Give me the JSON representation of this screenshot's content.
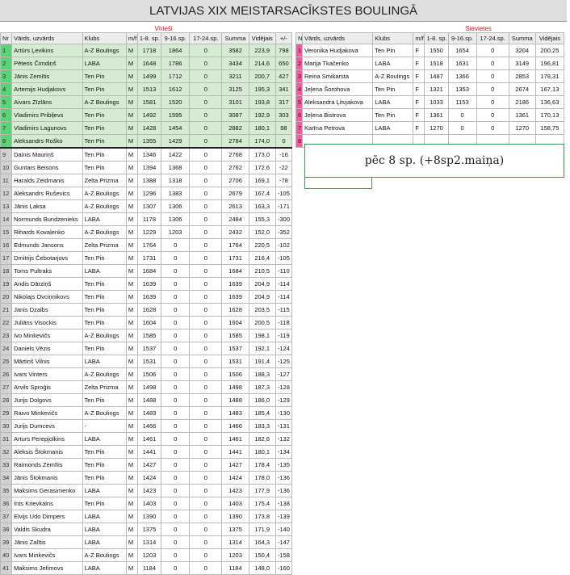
{
  "title": "LATVIJAS XIX MEISTARSACĪKSTES BOULINGĀ",
  "men": {
    "section_label": "Vīrieši",
    "headers": [
      "Nr",
      "Vārds, uzvārds",
      "Klubs",
      "m/f",
      "1-8. sp.",
      "9-16.sp.",
      "17-24.sp.",
      "Summa",
      "Vidējais",
      "+/-"
    ],
    "rows": [
      [
        "1",
        "Artūrs Ļevikins",
        "A-Z Boulings",
        "M",
        "1718",
        "1864",
        "0",
        "3582",
        "223,9",
        "798"
      ],
      [
        "2",
        "Pēteris Čimdiņš",
        "LABA",
        "M",
        "1648",
        "1786",
        "0",
        "3434",
        "214,6",
        "650"
      ],
      [
        "3",
        "Jānis Zemītis",
        "Ten Pin",
        "M",
        "1499",
        "1712",
        "0",
        "3211",
        "200,7",
        "427"
      ],
      [
        "4",
        "Artemijs Hudjakovs",
        "Ten Pin",
        "M",
        "1513",
        "1612",
        "0",
        "3125",
        "195,3",
        "341"
      ],
      [
        "5",
        "Aivars Zīzlāns",
        "A-Z Boulings",
        "M",
        "1581",
        "1520",
        "0",
        "3101",
        "193,8",
        "317"
      ],
      [
        "6",
        "Vladimirs Pribiļevs",
        "Ten Pin",
        "M",
        "1492",
        "1595",
        "0",
        "3087",
        "192,9",
        "303"
      ],
      [
        "7",
        "Vladimirs Lagunovs",
        "Ten Pin",
        "M",
        "1428",
        "1454",
        "0",
        "2882",
        "180,1",
        "98"
      ],
      [
        "8",
        "Aleksandrs Roško",
        "Ten Pin",
        "M",
        "1355",
        "1429",
        "0",
        "2784",
        "174,0",
        "0"
      ],
      [
        "9",
        "Dainis Mauriņš",
        "Ten Pin",
        "M",
        "1346",
        "1422",
        "0",
        "2768",
        "173,0",
        "-16"
      ],
      [
        "10",
        "Guntars Beisons",
        "Ten Pin",
        "M",
        "1394",
        "1368",
        "0",
        "2762",
        "172,6",
        "-22"
      ],
      [
        "11",
        "Haralds Zeidmanis",
        "Zelta Prizma",
        "M",
        "1388",
        "1318",
        "0",
        "2706",
        "169,1",
        "-78"
      ],
      [
        "12",
        "Aleksandrs Ruševics",
        "A-Z Boulings",
        "M",
        "1296",
        "1383",
        "0",
        "2679",
        "167,4",
        "-105"
      ],
      [
        "13",
        "Jānis Ļaksa",
        "A-Z Boulings",
        "M",
        "1307",
        "1306",
        "0",
        "2613",
        "163,3",
        "-171"
      ],
      [
        "14",
        "Normunds Bundzenieks",
        "LABA",
        "M",
        "1178",
        "1306",
        "0",
        "2484",
        "155,3",
        "-300"
      ],
      [
        "15",
        "Rihards Kovaļenko",
        "A-Z Boulings",
        "M",
        "1229",
        "1203",
        "0",
        "2432",
        "152,0",
        "-352"
      ],
      [
        "16",
        "Edmunds Jansons",
        "Zelta Prizma",
        "M",
        "1764",
        "0",
        "0",
        "1764",
        "220,5",
        "-102"
      ],
      [
        "17",
        "Dmitrijs Čebotarjovs",
        "Ten Pin",
        "M",
        "1731",
        "0",
        "0",
        "1731",
        "216,4",
        "-105"
      ],
      [
        "18",
        "Toms Pultraks",
        "LABA",
        "M",
        "1684",
        "0",
        "0",
        "1684",
        "210,5",
        "-110"
      ],
      [
        "19",
        "Andis Dārziņš",
        "Ten Pin",
        "M",
        "1639",
        "0",
        "0",
        "1639",
        "204,9",
        "-114"
      ],
      [
        "20",
        "Nikolajs Ovciņņikovs",
        "Ten Pin",
        "M",
        "1639",
        "0",
        "0",
        "1639",
        "204,9",
        "-114"
      ],
      [
        "21",
        "Janis Dzalbs",
        "Ten Pin",
        "M",
        "1628",
        "0",
        "0",
        "1628",
        "203,5",
        "-115"
      ],
      [
        "22",
        "Juliāns Visockis",
        "Ten Pin",
        "M",
        "1604",
        "0",
        "0",
        "1604",
        "200,5",
        "-118"
      ],
      [
        "23",
        "Ivo Minkevičs",
        "A-Z Boulings",
        "M",
        "1585",
        "0",
        "0",
        "1585",
        "198,1",
        "-119"
      ],
      [
        "24",
        "Daniels Vēzis",
        "Ten Pin",
        "M",
        "1537",
        "0",
        "0",
        "1537",
        "192,1",
        "-124"
      ],
      [
        "25",
        "Mārtiņš Vilnis",
        "LABA",
        "M",
        "1531",
        "0",
        "0",
        "1531",
        "191,4",
        "-125"
      ],
      [
        "26",
        "Ivars Vinters",
        "A-Z Boulings",
        "M",
        "1506",
        "0",
        "0",
        "1506",
        "188,3",
        "-127"
      ],
      [
        "27",
        "Arvils Sproģis",
        "Zelta Prizma",
        "M",
        "1498",
        "0",
        "0",
        "1498",
        "187,3",
        "-128"
      ],
      [
        "28",
        "Jurijs Dolgovs",
        "Ten Pin",
        "M",
        "1488",
        "0",
        "0",
        "1488",
        "186,0",
        "-129"
      ],
      [
        "29",
        "Raivo Minkevičs",
        "A-Z Boulings",
        "M",
        "1483",
        "0",
        "0",
        "1483",
        "185,4",
        "-130"
      ],
      [
        "30",
        "Jurijs Dumcevs",
        "-",
        "M",
        "1466",
        "0",
        "0",
        "1466",
        "183,3",
        "-131"
      ],
      [
        "31",
        "Arturs Perepjolkins",
        "LABA",
        "M",
        "1461",
        "0",
        "0",
        "1461",
        "182,6",
        "-132"
      ],
      [
        "32",
        "Aleksis Štokmanis",
        "Ten Pin",
        "M",
        "1441",
        "0",
        "0",
        "1441",
        "180,1",
        "-134"
      ],
      [
        "33",
        "Raimonds Zemītis",
        "Ten Pin",
        "M",
        "1427",
        "0",
        "0",
        "1427",
        "178,4",
        "-135"
      ],
      [
        "34",
        "Jānis Štokmanis",
        "Ten Pin",
        "M",
        "1424",
        "0",
        "0",
        "1424",
        "178,0",
        "-136"
      ],
      [
        "35",
        "Maksims Gerasimenko",
        "LABA",
        "M",
        "1423",
        "0",
        "0",
        "1423",
        "177,9",
        "-136"
      ],
      [
        "36",
        "Ints Krievkalns",
        "Ten Pin",
        "M",
        "1403",
        "0",
        "0",
        "1403",
        "175,4",
        "-138"
      ],
      [
        "37",
        "Elvijs Udo Dimpers",
        "LABA",
        "M",
        "1390",
        "0",
        "0",
        "1390",
        "173,8",
        "-139"
      ],
      [
        "38",
        "Valdis Skudra",
        "LABA",
        "M",
        "1375",
        "0",
        "0",
        "1375",
        "171,9",
        "-140"
      ],
      [
        "39",
        "Jānis Zalītis",
        "LABA",
        "M",
        "1314",
        "0",
        "0",
        "1314",
        "164,3",
        "-147"
      ],
      [
        "40",
        "Ivars Minkevičs",
        "A-Z Boulings",
        "M",
        "1203",
        "0",
        "0",
        "1203",
        "150,4",
        "-158"
      ],
      [
        "41",
        "Maksims Jefimovs",
        "LABA",
        "M",
        "1184",
        "0",
        "0",
        "1184",
        "148,0",
        "-160"
      ]
    ]
  },
  "women": {
    "section_label": "Sievietes",
    "headers": [
      "Nr",
      "Vārds, uzvārds",
      "Klubs",
      "m/f",
      "1-8. sp.",
      "9-16.sp.",
      "17-24.sp.",
      "Summa",
      "Vidējais"
    ],
    "rows": [
      [
        "1",
        "Veronika Hudjakova",
        "Ten Pin",
        "F",
        "1550",
        "1654",
        "0",
        "3204",
        "200,25"
      ],
      [
        "2",
        "Marija Tkačenko",
        "LABA",
        "F",
        "1518",
        "1631",
        "0",
        "3149",
        "196,81"
      ],
      [
        "3",
        "Reina Smikarsta",
        "A-Z Boulings",
        "F",
        "1487",
        "1366",
        "0",
        "2853",
        "178,31"
      ],
      [
        "4",
        "Jeļena Šorohova",
        "Ten Pin",
        "F",
        "1321",
        "1353",
        "0",
        "2674",
        "167,13"
      ],
      [
        "5",
        "Aleksandra Ļitvjakova",
        "LABA",
        "F",
        "1033",
        "1153",
        "0",
        "2186",
        "136,63"
      ],
      [
        "6",
        "Jeļena Bistrova",
        "Ten Pin",
        "F",
        "1361",
        "0",
        "0",
        "1361",
        "170,13"
      ],
      [
        "7",
        "Karīna Petrova",
        "LABA",
        "F",
        "1270",
        "0",
        "0",
        "1270",
        "158,75"
      ],
      [
        "8",
        "",
        "",
        "",
        "",
        "",
        "",
        "",
        ""
      ]
    ]
  },
  "note": "pēc 8 sp. (+8sp2.maiņa)"
}
